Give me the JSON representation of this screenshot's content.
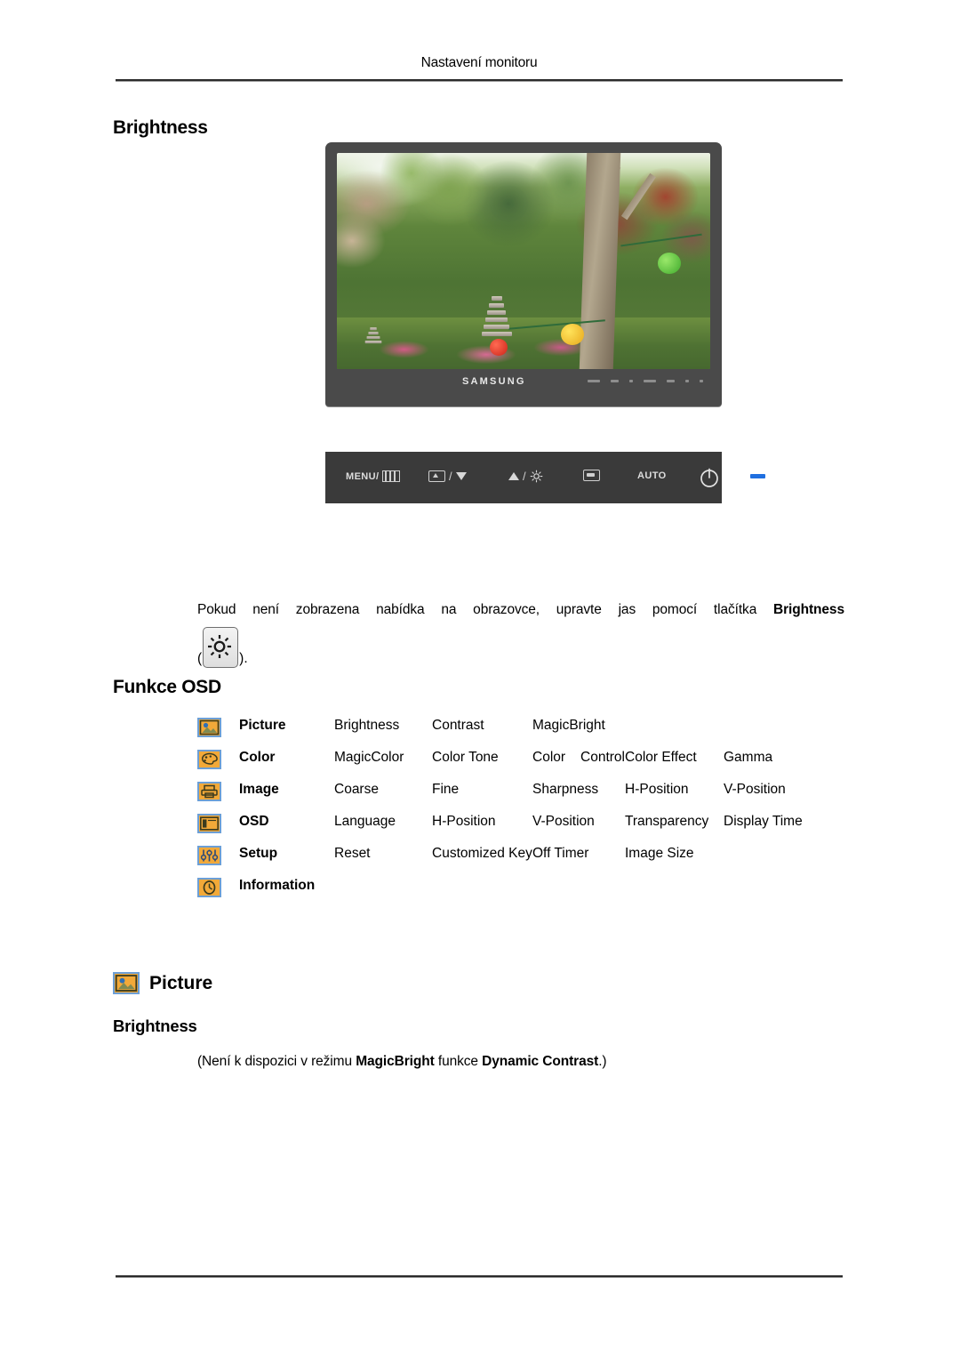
{
  "page": {
    "header_title": "Nastavení monitoru"
  },
  "sections": {
    "brightness_heading": "Brightness",
    "funkce_osd_heading": "Funkce OSD",
    "picture_heading": "Picture",
    "brightness_heading_2": "Brightness"
  },
  "monitor": {
    "brand": "SAMSUNG",
    "scene_description": "Zahrada s kamennými pagodami, stromy a lampiony"
  },
  "control_panel": {
    "menu_label": "MENU/",
    "source_label": "",
    "up_label": "",
    "enter_label": "",
    "auto_label": "AUTO",
    "separator": "/",
    "icons": {
      "menu": "menu-bars-icon",
      "source": "source-box-icon",
      "down": "triangle-down-icon",
      "up": "triangle-up-icon",
      "brightness": "sun-icon",
      "enter": "enter-box-icon",
      "power": "power-icon",
      "led": "led-indicator"
    }
  },
  "paragraph": {
    "line1": "Pokud není zobrazena nabídka na obrazovce, upravte jas pomocí tlačítka",
    "bold_term": "Brightness",
    "open_paren": "(",
    "close_paren": ").",
    "button_icon": "sun-icon"
  },
  "osd_table": {
    "rows": [
      {
        "icon": "picture-icon",
        "label": "Picture",
        "items": [
          "Brightness",
          "Contrast",
          "MagicBright",
          "",
          ""
        ]
      },
      {
        "icon": "color-palette-icon",
        "label": "Color",
        "items": [
          "MagicColor",
          "Color Tone",
          "Color Control",
          "Color Effect",
          "Gamma"
        ]
      },
      {
        "icon": "image-icon",
        "label": "Image",
        "items": [
          "Coarse",
          "Fine",
          "Sharpness",
          "H-Position",
          "V-Position"
        ]
      },
      {
        "icon": "osd-window-icon",
        "label": "OSD",
        "items": [
          "Language",
          "H-Position",
          "V-Position",
          "Transparency",
          "Display Time"
        ]
      },
      {
        "icon": "setup-sliders-icon",
        "label": "Setup",
        "items": [
          "Reset",
          "Customized Key",
          "Off Timer",
          "Image Size",
          ""
        ]
      },
      {
        "icon": "information-clock-icon",
        "label": "Information",
        "items": [
          "",
          "",
          "",
          "",
          ""
        ]
      }
    ]
  },
  "note": {
    "prefix": "(Není k dispozici v režimu ",
    "bold1": "MagicBright",
    "middle": " funkce ",
    "bold2": "Dynamic Contrast",
    "suffix": ".)"
  },
  "colors": {
    "icon_fill": "#f2a939",
    "icon_border": "#6c9fd6",
    "led_blue": "#1f6fe0",
    "bezel": "#4a4a4a",
    "panel": "#3a3a3a",
    "rule": "#2b2b2b"
  }
}
